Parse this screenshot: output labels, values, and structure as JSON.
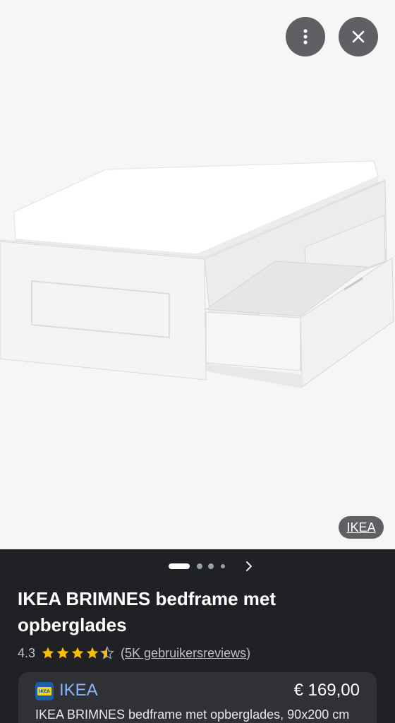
{
  "viewer": {
    "more_icon": "more-vert-icon",
    "close_icon": "close-icon",
    "source_badge": "IKEA",
    "background_color": "#f6f6f6"
  },
  "carousel": {
    "dot_count": 4,
    "active_index": 0,
    "next_icon": "chevron-right-icon"
  },
  "product": {
    "title": "IKEA BRIMNES bedframe met opberglades",
    "rating": "4.3",
    "rating_value": 4.3,
    "rating_max": 5,
    "reviews_open": "(",
    "reviews_label": "5K gebruikersreviews",
    "reviews_close": ")"
  },
  "offer": {
    "store": "IKEA",
    "price": "€ 169,00",
    "description": "IKEA BRIMNES bedframe met opberglades, 90x200 cm"
  },
  "colors": {
    "panel_bg": "#202124",
    "card_bg": "#303134",
    "link": "#8ab4f8",
    "star": "#fbbc04"
  }
}
